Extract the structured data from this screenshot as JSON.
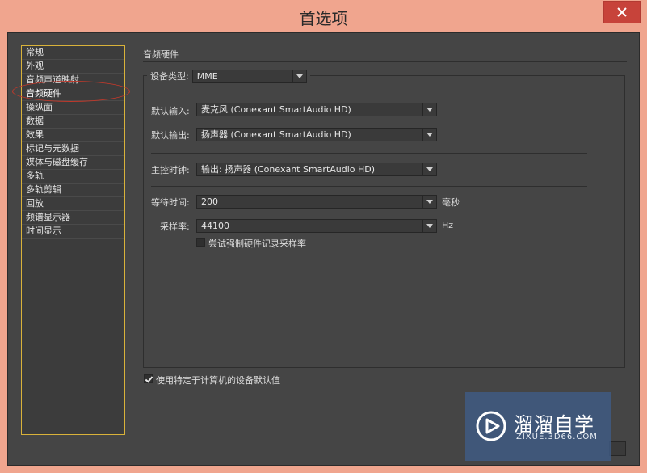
{
  "window": {
    "title": "首选项"
  },
  "sidebar": {
    "items": [
      {
        "label": "常规"
      },
      {
        "label": "外观"
      },
      {
        "label": "音频声道映射"
      },
      {
        "label": "音频硬件"
      },
      {
        "label": "操纵面"
      },
      {
        "label": "数据"
      },
      {
        "label": "效果"
      },
      {
        "label": "标记与元数据"
      },
      {
        "label": "媒体与磁盘缓存"
      },
      {
        "label": "多轨"
      },
      {
        "label": "多轨剪辑"
      },
      {
        "label": "回放"
      },
      {
        "label": "频谱显示器"
      },
      {
        "label": "时间显示"
      }
    ],
    "selected": "音频硬件"
  },
  "panel": {
    "section_title": "音频硬件",
    "device_type": {
      "label": "设备类型:",
      "value": "MME"
    },
    "default_input": {
      "label": "默认输入:",
      "value": "麦克风 (Conexant SmartAudio HD)"
    },
    "default_output": {
      "label": "默认输出:",
      "value": "扬声器 (Conexant SmartAudio HD)"
    },
    "master_clock": {
      "label": "主控时钟:",
      "value": "输出: 扬声器 (Conexant SmartAudio HD)"
    },
    "latency": {
      "label": "等待时间:",
      "value": "200",
      "unit": "毫秒"
    },
    "sample_rate": {
      "label": "采样率:",
      "value": "44100",
      "unit": "Hz"
    },
    "force_sample_rate": {
      "label": "尝试强制硬件记录采样率",
      "checked": false
    }
  },
  "footer": {
    "use_defaults": {
      "label": "使用特定于计算机的设备默认值",
      "checked": true
    }
  },
  "watermark": {
    "brand": "溜溜自学",
    "url": "ZIXUE.3D66.COM"
  },
  "colors": {
    "window_frame": "#f0a58e",
    "close_button": "#c7433a",
    "panel_bg": "#454545",
    "sidebar_border": "#d9b23a",
    "highlight_ellipse": "#c0392b"
  }
}
